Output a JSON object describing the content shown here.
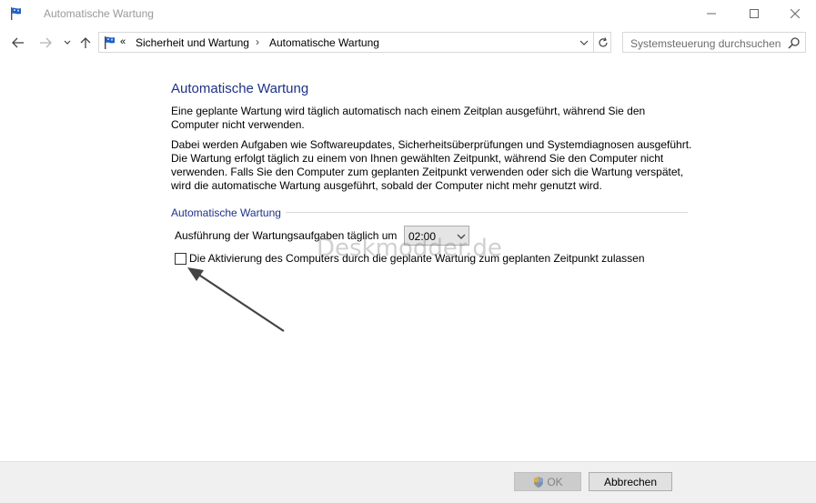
{
  "window": {
    "title": "Automatische Wartung"
  },
  "nav": {
    "breadcrumb_prefix": "«",
    "breadcrumb": [
      "Sicherheit und Wartung",
      "Automatische Wartung"
    ],
    "breadcrumb_separator": "›",
    "search_placeholder": "Systemsteuerung durchsuchen"
  },
  "content": {
    "title": "Automatische Wartung",
    "paragraph1": "Eine geplante Wartung wird täglich automatisch nach einem Zeitplan ausgeführt, während Sie den Computer nicht verwenden.",
    "paragraph2": "Dabei werden Aufgaben wie Softwareupdates, Sicherheitsüberprüfungen und Systemdiagnosen ausgeführt. Die Wartung erfolgt täglich zu einem von Ihnen gewählten Zeitpunkt, während Sie den Computer nicht verwenden. Falls Sie den Computer zum geplanten Zeitpunkt verwenden oder sich die Wartung verspätet, wird die automatische Wartung ausgeführt, sobald der Computer nicht mehr genutzt wird.",
    "section_heading": "Automatische Wartung",
    "time_label": "Ausführung der Wartungsaufgaben täglich um",
    "time_value": "02:00",
    "wake_label": "Die Aktivierung des Computers durch die geplante Wartung zum geplanten Zeitpunkt zulassen",
    "wake_checked": false,
    "watermark": "Deskmodder.de"
  },
  "footer": {
    "ok_label": "OK",
    "cancel_label": "Abbrechen"
  },
  "colors": {
    "heading": "#1e3287",
    "flag_blue": "#1c5fc7"
  },
  "icons": {
    "app": "flag-icon",
    "back": "arrow-left-icon",
    "forward": "arrow-right-icon",
    "recent": "chevron-down-icon",
    "up": "arrow-up-icon",
    "refresh": "refresh-icon",
    "search": "search-icon",
    "shield": "uac-shield-icon"
  }
}
